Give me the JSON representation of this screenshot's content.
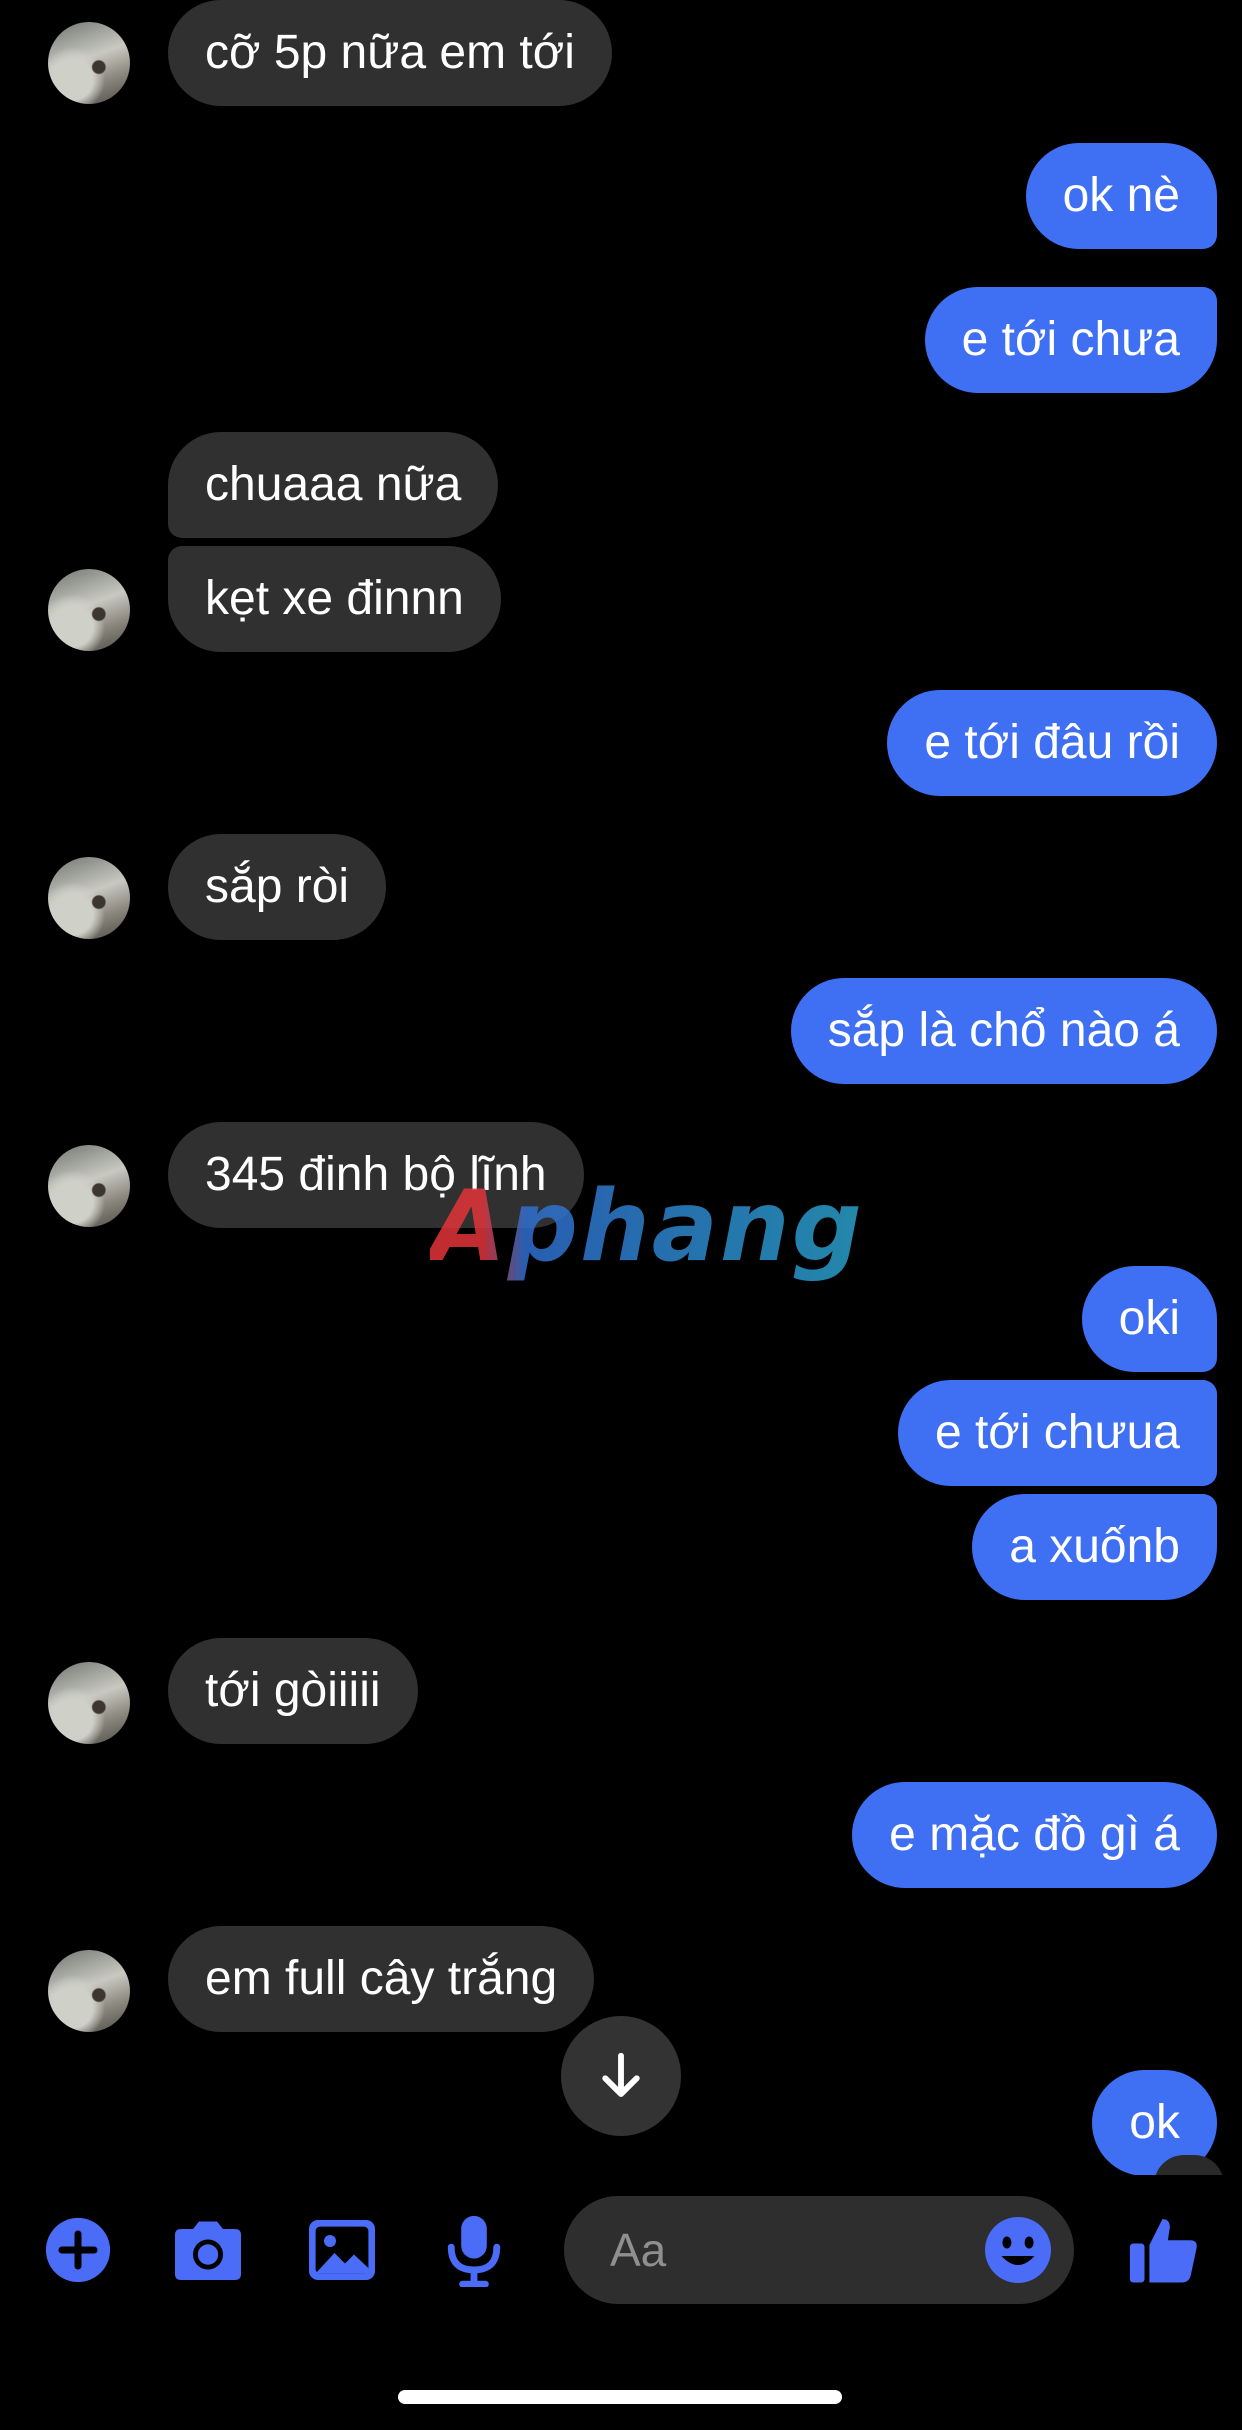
{
  "theme": {
    "incoming_bubble": "#303030",
    "outgoing_bubble": "#3f6ff3",
    "accent": "#4a6cf7",
    "background": "#000000"
  },
  "messages": [
    {
      "dir": "in",
      "text": "cỡ 5p nữa em tới"
    },
    {
      "dir": "out",
      "text": "ok nè"
    },
    {
      "dir": "out",
      "text": "e tới chưa"
    },
    {
      "dir": "in",
      "text": "chuaaa nữa"
    },
    {
      "dir": "in",
      "text": "kẹt xe đinnn"
    },
    {
      "dir": "out",
      "text": "e tới đâu rồi"
    },
    {
      "dir": "in",
      "text": "sắp ròi"
    },
    {
      "dir": "out",
      "text": "sắp là chổ nào á"
    },
    {
      "dir": "in",
      "text": "345 đinh bộ lĩnh"
    },
    {
      "dir": "out",
      "text": "oki"
    },
    {
      "dir": "out",
      "text": "e tới chưua"
    },
    {
      "dir": "out",
      "text": "a xuốnb"
    },
    {
      "dir": "in",
      "text": "tới gòiiiii"
    },
    {
      "dir": "out",
      "text": "e mặc đồ gì á"
    },
    {
      "dir": "in",
      "text": "em full cây trắng"
    },
    {
      "dir": "out",
      "text": "ok"
    }
  ],
  "watermark": "Aphang",
  "composer": {
    "placeholder": "Aa",
    "icons": [
      "plus-icon",
      "camera-icon",
      "image-icon",
      "microphone-icon",
      "emoji-icon",
      "thumbs-up-icon"
    ]
  }
}
